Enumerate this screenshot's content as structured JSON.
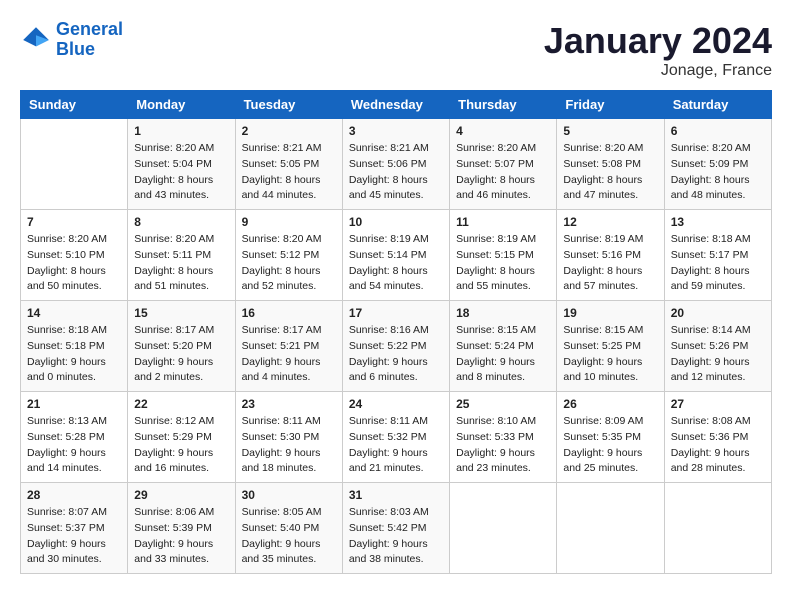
{
  "header": {
    "logo_line1": "General",
    "logo_line2": "Blue",
    "title": "January 2024",
    "subtitle": "Jonage, France"
  },
  "calendar": {
    "weekdays": [
      "Sunday",
      "Monday",
      "Tuesday",
      "Wednesday",
      "Thursday",
      "Friday",
      "Saturday"
    ],
    "weeks": [
      [
        {
          "day": "",
          "sunrise": "",
          "sunset": "",
          "daylight": ""
        },
        {
          "day": "1",
          "sunrise": "Sunrise: 8:20 AM",
          "sunset": "Sunset: 5:04 PM",
          "daylight": "Daylight: 8 hours and 43 minutes."
        },
        {
          "day": "2",
          "sunrise": "Sunrise: 8:21 AM",
          "sunset": "Sunset: 5:05 PM",
          "daylight": "Daylight: 8 hours and 44 minutes."
        },
        {
          "day": "3",
          "sunrise": "Sunrise: 8:21 AM",
          "sunset": "Sunset: 5:06 PM",
          "daylight": "Daylight: 8 hours and 45 minutes."
        },
        {
          "day": "4",
          "sunrise": "Sunrise: 8:20 AM",
          "sunset": "Sunset: 5:07 PM",
          "daylight": "Daylight: 8 hours and 46 minutes."
        },
        {
          "day": "5",
          "sunrise": "Sunrise: 8:20 AM",
          "sunset": "Sunset: 5:08 PM",
          "daylight": "Daylight: 8 hours and 47 minutes."
        },
        {
          "day": "6",
          "sunrise": "Sunrise: 8:20 AM",
          "sunset": "Sunset: 5:09 PM",
          "daylight": "Daylight: 8 hours and 48 minutes."
        }
      ],
      [
        {
          "day": "7",
          "sunrise": "Sunrise: 8:20 AM",
          "sunset": "Sunset: 5:10 PM",
          "daylight": "Daylight: 8 hours and 50 minutes."
        },
        {
          "day": "8",
          "sunrise": "Sunrise: 8:20 AM",
          "sunset": "Sunset: 5:11 PM",
          "daylight": "Daylight: 8 hours and 51 minutes."
        },
        {
          "day": "9",
          "sunrise": "Sunrise: 8:20 AM",
          "sunset": "Sunset: 5:12 PM",
          "daylight": "Daylight: 8 hours and 52 minutes."
        },
        {
          "day": "10",
          "sunrise": "Sunrise: 8:19 AM",
          "sunset": "Sunset: 5:14 PM",
          "daylight": "Daylight: 8 hours and 54 minutes."
        },
        {
          "day": "11",
          "sunrise": "Sunrise: 8:19 AM",
          "sunset": "Sunset: 5:15 PM",
          "daylight": "Daylight: 8 hours and 55 minutes."
        },
        {
          "day": "12",
          "sunrise": "Sunrise: 8:19 AM",
          "sunset": "Sunset: 5:16 PM",
          "daylight": "Daylight: 8 hours and 57 minutes."
        },
        {
          "day": "13",
          "sunrise": "Sunrise: 8:18 AM",
          "sunset": "Sunset: 5:17 PM",
          "daylight": "Daylight: 8 hours and 59 minutes."
        }
      ],
      [
        {
          "day": "14",
          "sunrise": "Sunrise: 8:18 AM",
          "sunset": "Sunset: 5:18 PM",
          "daylight": "Daylight: 9 hours and 0 minutes."
        },
        {
          "day": "15",
          "sunrise": "Sunrise: 8:17 AM",
          "sunset": "Sunset: 5:20 PM",
          "daylight": "Daylight: 9 hours and 2 minutes."
        },
        {
          "day": "16",
          "sunrise": "Sunrise: 8:17 AM",
          "sunset": "Sunset: 5:21 PM",
          "daylight": "Daylight: 9 hours and 4 minutes."
        },
        {
          "day": "17",
          "sunrise": "Sunrise: 8:16 AM",
          "sunset": "Sunset: 5:22 PM",
          "daylight": "Daylight: 9 hours and 6 minutes."
        },
        {
          "day": "18",
          "sunrise": "Sunrise: 8:15 AM",
          "sunset": "Sunset: 5:24 PM",
          "daylight": "Daylight: 9 hours and 8 minutes."
        },
        {
          "day": "19",
          "sunrise": "Sunrise: 8:15 AM",
          "sunset": "Sunset: 5:25 PM",
          "daylight": "Daylight: 9 hours and 10 minutes."
        },
        {
          "day": "20",
          "sunrise": "Sunrise: 8:14 AM",
          "sunset": "Sunset: 5:26 PM",
          "daylight": "Daylight: 9 hours and 12 minutes."
        }
      ],
      [
        {
          "day": "21",
          "sunrise": "Sunrise: 8:13 AM",
          "sunset": "Sunset: 5:28 PM",
          "daylight": "Daylight: 9 hours and 14 minutes."
        },
        {
          "day": "22",
          "sunrise": "Sunrise: 8:12 AM",
          "sunset": "Sunset: 5:29 PM",
          "daylight": "Daylight: 9 hours and 16 minutes."
        },
        {
          "day": "23",
          "sunrise": "Sunrise: 8:11 AM",
          "sunset": "Sunset: 5:30 PM",
          "daylight": "Daylight: 9 hours and 18 minutes."
        },
        {
          "day": "24",
          "sunrise": "Sunrise: 8:11 AM",
          "sunset": "Sunset: 5:32 PM",
          "daylight": "Daylight: 9 hours and 21 minutes."
        },
        {
          "day": "25",
          "sunrise": "Sunrise: 8:10 AM",
          "sunset": "Sunset: 5:33 PM",
          "daylight": "Daylight: 9 hours and 23 minutes."
        },
        {
          "day": "26",
          "sunrise": "Sunrise: 8:09 AM",
          "sunset": "Sunset: 5:35 PM",
          "daylight": "Daylight: 9 hours and 25 minutes."
        },
        {
          "day": "27",
          "sunrise": "Sunrise: 8:08 AM",
          "sunset": "Sunset: 5:36 PM",
          "daylight": "Daylight: 9 hours and 28 minutes."
        }
      ],
      [
        {
          "day": "28",
          "sunrise": "Sunrise: 8:07 AM",
          "sunset": "Sunset: 5:37 PM",
          "daylight": "Daylight: 9 hours and 30 minutes."
        },
        {
          "day": "29",
          "sunrise": "Sunrise: 8:06 AM",
          "sunset": "Sunset: 5:39 PM",
          "daylight": "Daylight: 9 hours and 33 minutes."
        },
        {
          "day": "30",
          "sunrise": "Sunrise: 8:05 AM",
          "sunset": "Sunset: 5:40 PM",
          "daylight": "Daylight: 9 hours and 35 minutes."
        },
        {
          "day": "31",
          "sunrise": "Sunrise: 8:03 AM",
          "sunset": "Sunset: 5:42 PM",
          "daylight": "Daylight: 9 hours and 38 minutes."
        },
        {
          "day": "",
          "sunrise": "",
          "sunset": "",
          "daylight": ""
        },
        {
          "day": "",
          "sunrise": "",
          "sunset": "",
          "daylight": ""
        },
        {
          "day": "",
          "sunrise": "",
          "sunset": "",
          "daylight": ""
        }
      ]
    ]
  }
}
